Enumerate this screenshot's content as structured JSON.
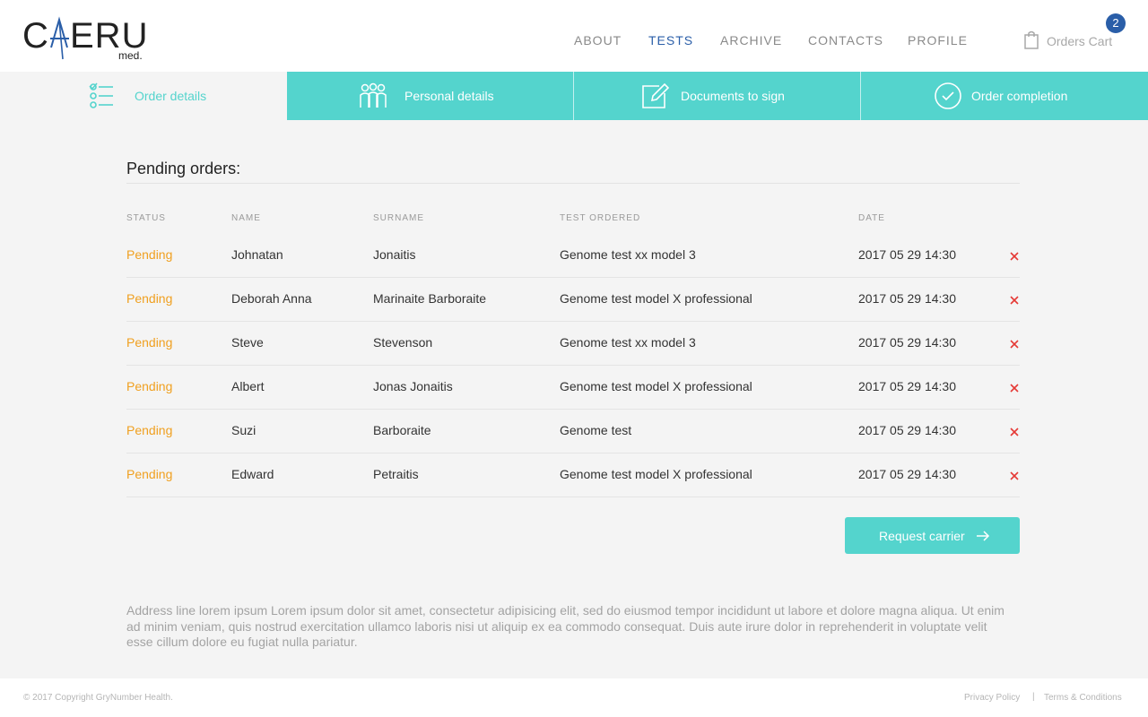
{
  "brand": {
    "logo_text": "CAERUS",
    "logo_sub": "med."
  },
  "nav": [
    {
      "label": "ABOUT"
    },
    {
      "label": "TESTS"
    },
    {
      "label": "ARCHIVE"
    },
    {
      "label": "CONTACTS"
    },
    {
      "label": "PROFILE"
    }
  ],
  "cart": {
    "label": "Orders Cart",
    "count": "2",
    "icon": "shopping-bag-icon"
  },
  "steps": [
    {
      "label": "Order details",
      "icon": "checklist-icon"
    },
    {
      "label": "Personal details",
      "icon": "people-icon"
    },
    {
      "label": "Documents to sign",
      "icon": "edit-document-icon"
    },
    {
      "label": "Order completion",
      "icon": "check-circle-icon"
    }
  ],
  "main": {
    "title": "Pending orders:",
    "columns": [
      "STATUS",
      "NAME",
      "SURNAME",
      "TEST ORDERED",
      "DATE"
    ],
    "rows": [
      {
        "status": "Pending",
        "name": "Johnatan",
        "surname": "Jonaitis",
        "test": "Genome test xx model 3",
        "date": "2017 05 29  14:30"
      },
      {
        "status": "Pending",
        "name": "Deborah Anna",
        "surname": "Marinaite Barboraite",
        "test": "Genome test model X professional",
        "date": "2017 05 29  14:30"
      },
      {
        "status": "Pending",
        "name": "Steve",
        "surname": "Stevenson",
        "test": "Genome test xx model 3",
        "date": "2017 05 29  14:30"
      },
      {
        "status": "Pending",
        "name": "Albert",
        "surname": "Jonas Jonaitis",
        "test": "Genome test model X professional",
        "date": "2017 05 29  14:30"
      },
      {
        "status": "Pending",
        "name": "Suzi",
        "surname": "Barboraite",
        "test": "Genome test",
        "date": "2017 05 29  14:30"
      },
      {
        "status": "Pending",
        "name": "Edward",
        "surname": "Petraitis",
        "test": "Genome test model X professional",
        "date": "2017 05 29  14:30"
      }
    ],
    "action_label": "Request carrier",
    "address": "Address line lorem ipsum Lorem ipsum dolor sit amet, consectetur adipisicing elit, sed do eiusmod tempor incididunt ut labore et dolore magna aliqua. Ut enim ad minim veniam, quis nostrud exercitation ullamco laboris nisi ut aliquip ex ea commodo consequat. Duis aute irure dolor in reprehenderit in voluptate velit esse cillum dolore eu fugiat nulla pariatur."
  },
  "footer": {
    "copyright": "© 2017 Copyright GryNumber Health.",
    "privacy": "Privacy Policy",
    "separator": "|",
    "terms": "Terms & Conditions"
  },
  "colors": {
    "accent": "#54d4cd",
    "brand_blue": "#2a5ea8",
    "pending": "#f0a020",
    "delete": "#e53935"
  }
}
